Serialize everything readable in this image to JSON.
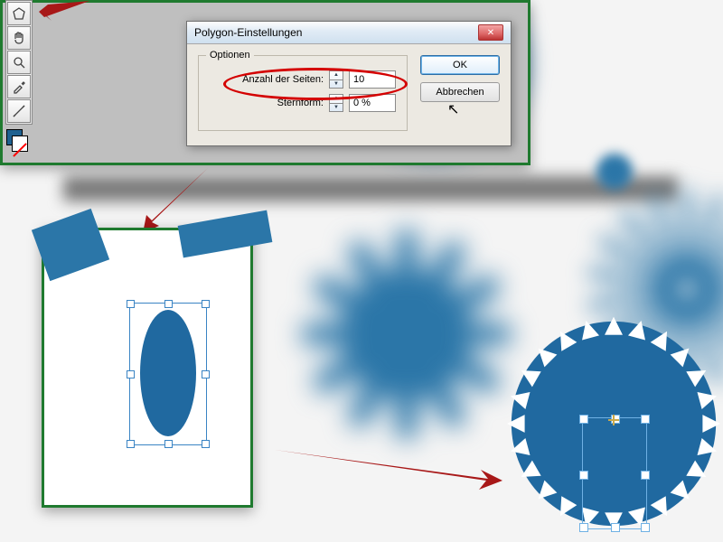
{
  "dialog": {
    "title": "Polygon-Einstellungen",
    "group_label": "Optionen",
    "sides_label": "Anzahl der Seiten:",
    "sides_value": "10",
    "star_label": "Sternform:",
    "star_value": "0 %",
    "ok_label": "OK",
    "cancel_label": "Abbrechen"
  },
  "tools": {
    "polygon": "polygon-tool",
    "hand": "hand-tool",
    "zoom": "zoom-tool",
    "eyedrop": "eyedropper-tool",
    "measure": "measure-tool"
  },
  "colors": {
    "accent": "#2069a0",
    "highlight": "#d40000",
    "panel_border": "#1f7a2f"
  }
}
